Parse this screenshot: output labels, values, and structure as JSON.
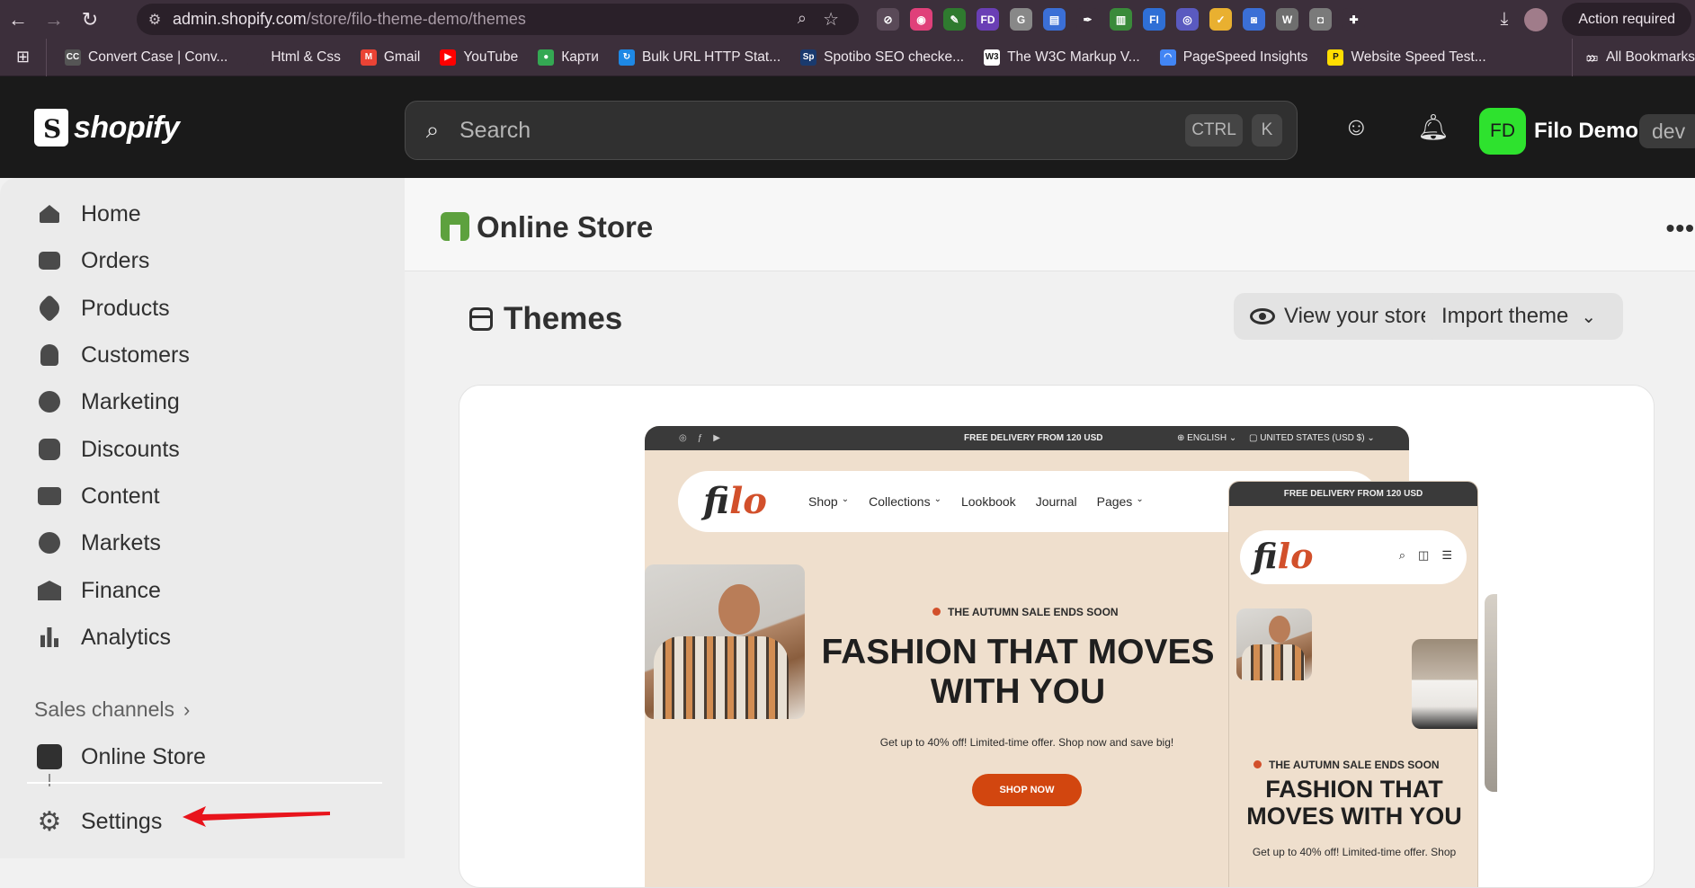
{
  "browser": {
    "url_host": "admin.shopify.com",
    "url_path": "/store/filo-theme-demo/themes",
    "action_required": "Action required",
    "bookmarks": [
      {
        "label": "Convert Case | Conv...",
        "icon": "cc-icon",
        "color": "#555555",
        "glyph": "CC"
      },
      {
        "label": "Html & Css",
        "icon": "folder-icon",
        "color": "#3c2f3b",
        "glyph": ""
      },
      {
        "label": "Gmail",
        "icon": "gmail-icon",
        "color": "#ea4335",
        "glyph": "M"
      },
      {
        "label": "YouTube",
        "icon": "youtube-icon",
        "color": "#ff0000",
        "glyph": "▶"
      },
      {
        "label": "Карти",
        "icon": "maps-icon",
        "color": "#34a853",
        "glyph": "●"
      },
      {
        "label": "Bulk URL HTTP Stat...",
        "icon": "bulk-url-icon",
        "color": "#1e88e5",
        "glyph": "↻"
      },
      {
        "label": "Spotibo SEO checke...",
        "icon": "spotibo-icon",
        "color": "#1a3a6e",
        "glyph": "Sp"
      },
      {
        "label": "The W3C Markup V...",
        "icon": "w3c-icon",
        "color": "#ffffff",
        "glyph": "W3"
      },
      {
        "label": "PageSpeed Insights",
        "icon": "pagespeed-icon",
        "color": "#4285f4",
        "glyph": "◠"
      },
      {
        "label": "Website Speed Test...",
        "icon": "speedtest-icon",
        "color": "#ffdd00",
        "glyph": "P"
      }
    ],
    "all_bookmarks": "All Bookmarks"
  },
  "topbar": {
    "logo": "shopify",
    "search_placeholder": "Search",
    "kbd_ctrl": "CTRL",
    "kbd_k": "K",
    "avatar_initials": "FD",
    "store_name": "Filo Demo",
    "badge": "dev"
  },
  "sidebar": {
    "items": [
      {
        "label": "Home",
        "icon": "home-icon"
      },
      {
        "label": "Orders",
        "icon": "inbox-icon"
      },
      {
        "label": "Products",
        "icon": "tag-icon"
      },
      {
        "label": "Customers",
        "icon": "person-icon"
      },
      {
        "label": "Marketing",
        "icon": "target-icon"
      },
      {
        "label": "Discounts",
        "icon": "discount-icon"
      },
      {
        "label": "Content",
        "icon": "image-icon"
      },
      {
        "label": "Markets",
        "icon": "globe-icon"
      },
      {
        "label": "Finance",
        "icon": "bank-icon"
      },
      {
        "label": "Analytics",
        "icon": "bar-chart-icon"
      }
    ],
    "sales_channels": "Sales channels",
    "online_store": "Online Store",
    "settings": "Settings"
  },
  "main": {
    "header_title": "Online Store",
    "section_title": "Themes",
    "view_store": "View your store",
    "import_theme": "Import theme"
  },
  "preview": {
    "announcement": "FREE DELIVERY FROM 120 USD",
    "language": "ENGLISH",
    "currency": "UNITED STATES (USD $)",
    "logo_fi": "fi",
    "logo_lo": "lo",
    "nav": [
      "Shop",
      "Collections",
      "Lookbook",
      "Journal",
      "Pages"
    ],
    "sale_text": "THE AUTUMN SALE ENDS SOON",
    "headline_1": "FASHION THAT MOVES",
    "headline_2": "WITH YOU",
    "mobile_headline_1": "FASHION THAT",
    "mobile_headline_2": "MOVES WITH YOU",
    "subtext": "Get up to 40% off! Limited-time offer. Shop now and save big!",
    "mobile_subtext": "Get up to 40% off! Limited-time offer. Shop",
    "cta": "SHOP NOW"
  },
  "colors": {
    "accent_green": "#2ee22e",
    "filo_orange": "#d2502b",
    "cta_orange": "#d2460f",
    "annotation_arrow": "#e8141c"
  }
}
